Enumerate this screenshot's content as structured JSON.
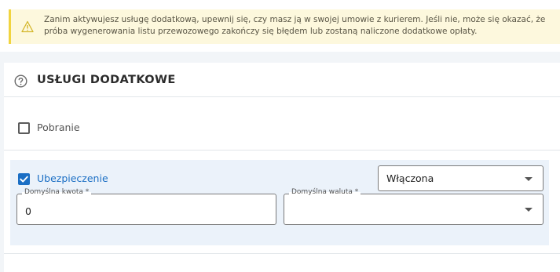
{
  "alert": {
    "icon": "warning-triangle-icon",
    "text": "Zanim aktywujesz usługę dodatkową, upewnij się, czy masz ją w swojej umowie z kurierem. Jeśli nie, może się okazać, że próba wygenerowania listu przewozowego zakończy się błędem lub zostaną naliczone dodatkowe opłaty.",
    "border_color": "#f1d43f",
    "background": "#fdf8dd"
  },
  "section": {
    "title": "USŁUGI DODATKOWE",
    "icon": "help-circle-icon"
  },
  "services": [
    {
      "label": "Pobranie",
      "checked": false
    },
    {
      "label": "Ubezpieczenie",
      "checked": true
    }
  ],
  "insurance": {
    "status_value": "Włączona",
    "amount_label": "Domyślna kwota *",
    "amount_value": "0",
    "currency_label": "Domyślna waluta *",
    "currency_value": ""
  },
  "colors": {
    "accent": "#1a6ec4",
    "active_row_bg": "#ebf2fa"
  }
}
